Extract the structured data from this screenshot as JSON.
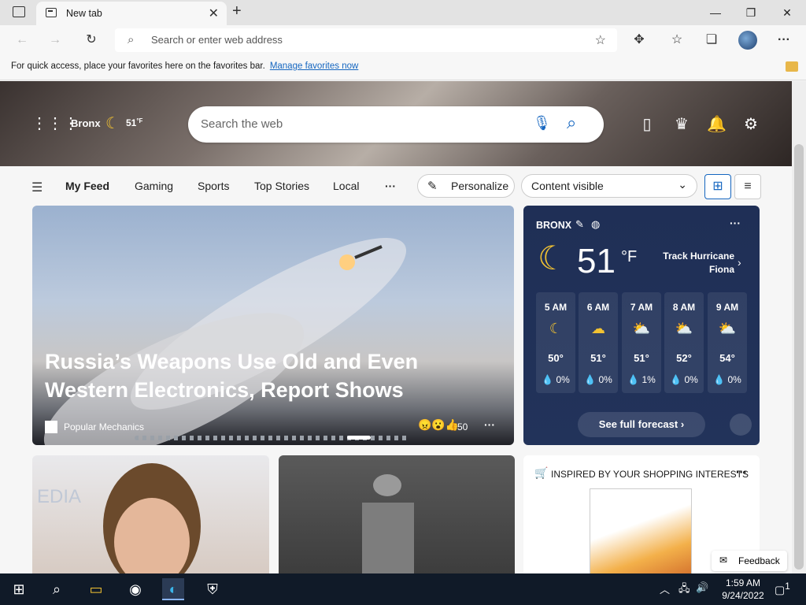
{
  "browser": {
    "tab_title": "New tab",
    "address_placeholder": "Search or enter web address"
  },
  "favbar": {
    "text": "For quick access, place your favorites here on the favorites bar.",
    "link": "Manage favorites now"
  },
  "hero": {
    "location": "Bronx",
    "temp": "51",
    "unit": "°F",
    "search_placeholder": "Search the web"
  },
  "feed": {
    "menu_tabs": [
      "My Feed",
      "Gaming",
      "Sports",
      "Top Stories",
      "Local"
    ],
    "more": "···",
    "personalize": "Personalize",
    "content_select": "Content visible"
  },
  "main_story": {
    "headline": "Russia’s Weapons Use Old and Even Western Electronics, Report Shows",
    "source": "Popular Mechanics",
    "reactions": "50"
  },
  "weather": {
    "city": "BRONX",
    "temp": "51",
    "unit": "°F",
    "alert": "Track Hurricane Fiona",
    "hours": [
      {
        "time": "5 AM",
        "temp": "50°",
        "precip": "0%"
      },
      {
        "time": "6 AM",
        "temp": "51°",
        "precip": "0%"
      },
      {
        "time": "7 AM",
        "temp": "51°",
        "precip": "1%"
      },
      {
        "time": "8 AM",
        "temp": "52°",
        "precip": "0%"
      },
      {
        "time": "9 AM",
        "temp": "54°",
        "precip": "0%"
      }
    ],
    "forecast_button": "See full forecast"
  },
  "shopping": {
    "title": "INSPIRED BY YOUR SHOPPING INTERESTS"
  },
  "feedback": "Feedback",
  "taskbar": {
    "time": "1:59 AM",
    "date": "9/24/2022",
    "notification_count": "1"
  }
}
